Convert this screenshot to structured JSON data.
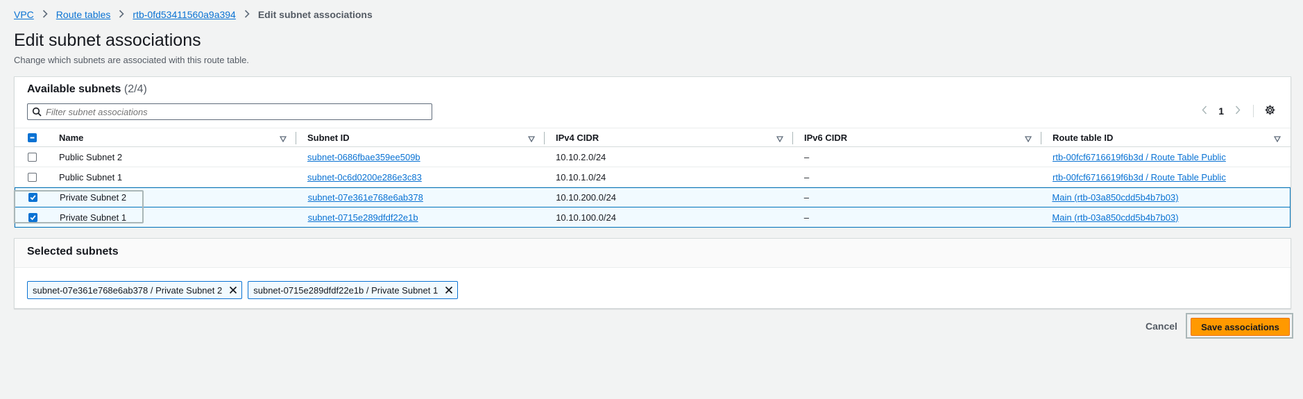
{
  "breadcrumb": {
    "items": [
      "VPC",
      "Route tables",
      "rtb-0fd53411560a9a394"
    ],
    "current": "Edit subnet associations"
  },
  "page": {
    "title": "Edit subnet associations",
    "description": "Change which subnets are associated with this route table."
  },
  "available": {
    "title": "Available subnets",
    "count": "(2/4)",
    "filter_placeholder": "Filter subnet associations",
    "page": "1",
    "columns": [
      "Name",
      "Subnet ID",
      "IPv4 CIDR",
      "IPv6 CIDR",
      "Route table ID"
    ],
    "rows": [
      {
        "name": "Public Subnet 2",
        "subnet_id": "subnet-0686fbae359ee509b",
        "ipv4": "10.10.2.0/24",
        "ipv6": "–",
        "route_table": "rtb-00fcf6716619f6b3d / Route Table Public",
        "checked": false
      },
      {
        "name": "Public Subnet 1",
        "subnet_id": "subnet-0c6d0200e286e3c83",
        "ipv4": "10.10.1.0/24",
        "ipv6": "–",
        "route_table": "rtb-00fcf6716619f6b3d / Route Table Public",
        "checked": false
      },
      {
        "name": "Private Subnet 2",
        "subnet_id": "subnet-07e361e768e6ab378",
        "ipv4": "10.10.200.0/24",
        "ipv6": "–",
        "route_table": "Main (rtb-03a850cdd5b4b7b03)",
        "checked": true
      },
      {
        "name": "Private Subnet 1",
        "subnet_id": "subnet-0715e289dfdf22e1b",
        "ipv4": "10.10.100.0/24",
        "ipv6": "–",
        "route_table": "Main (rtb-03a850cdd5b4b7b03)",
        "checked": true
      }
    ]
  },
  "selected": {
    "title": "Selected subnets",
    "tokens": [
      "subnet-07e361e768e6ab378 / Private Subnet 2",
      "subnet-0715e289dfdf22e1b / Private Subnet 1"
    ]
  },
  "actions": {
    "cancel": "Cancel",
    "save": "Save associations"
  },
  "colors": {
    "link": "#0972d3",
    "primary_button": "#ff9900",
    "selected_row_bg": "#f1faff"
  }
}
